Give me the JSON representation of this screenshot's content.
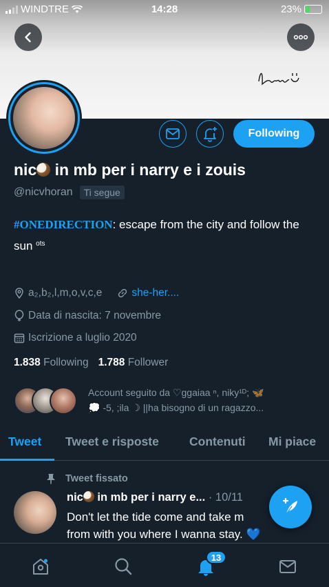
{
  "status_bar": {
    "carrier": "WINDTRE",
    "time": "14:28",
    "battery": "23%",
    "battery_level": 0.23
  },
  "banner": {
    "signature_text": "Louis :-)"
  },
  "header": {
    "follow_button_label": "Following",
    "accent_color": "#1da1f2"
  },
  "profile": {
    "name_part1": "nic",
    "name_part2": " in mb per i narry e i zouis",
    "handle": "@nicvhoran",
    "follows_you": "Ti segue",
    "bio_hashtag": "#ONEDIRECTION",
    "bio_text": ": escape from the city and follow the sun",
    "bio_sup": "ots",
    "location": "a₂,b₂,l,m,o,v,c,e",
    "website": "she-her....",
    "birthday": "Data di nascita: 7 novembre",
    "joined": "Iscrizione a luglio 2020",
    "following_count": "1.838",
    "following_label": "Following",
    "followers_count": "1.788",
    "followers_label": "Follower",
    "followed_by_line1": "Account seguito da ♡ggaiaa ⁿ, niky¹ᴰ; 🦋",
    "followed_by_line2": "💭 -5, ;ila ☽ ||ha bisogno di un ragazzo..."
  },
  "tabs": [
    {
      "label": "Tweet"
    },
    {
      "label": "Tweet e risposte"
    },
    {
      "label": "Contenuti"
    },
    {
      "label": "Mi piace"
    }
  ],
  "pinned_tweet": {
    "pinned_label": "Tweet fissato",
    "author_part1": "nic",
    "author_part2": " in mb per i narry e...",
    "date": " · 10/11",
    "line1": "Don't let the tide come and take m",
    "line2": "from with you where I wanna stay.",
    "line2_suffix": "💙"
  },
  "bottom_nav": {
    "notif_badge": "13"
  }
}
